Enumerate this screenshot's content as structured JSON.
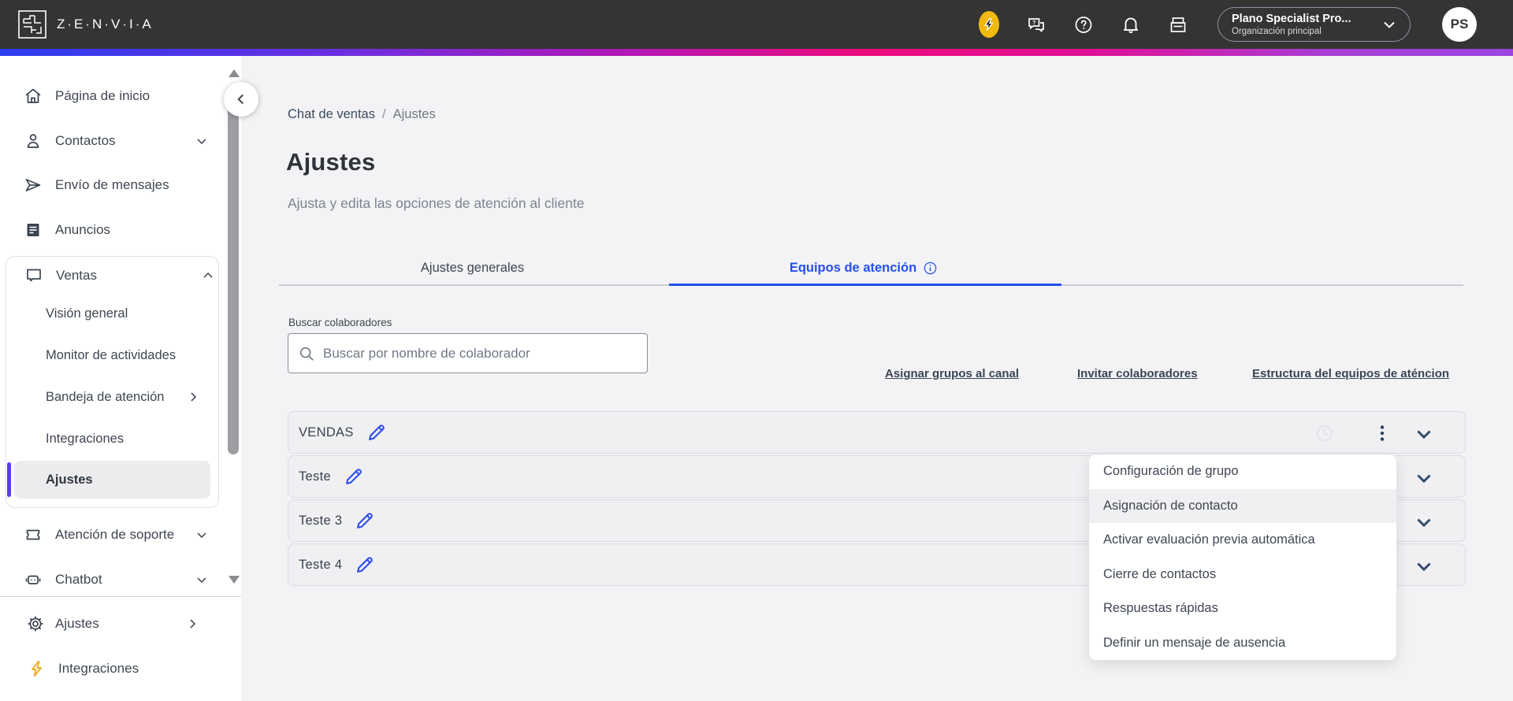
{
  "header": {
    "logo_text": "Z·E·N·V·I·A",
    "plan": {
      "name": "Plano Specialist Pro...",
      "org": "Organización principal"
    },
    "avatar_initials": "PS"
  },
  "sidebar": {
    "items": [
      {
        "label": "Página de inicio"
      },
      {
        "label": "Contactos"
      },
      {
        "label": "Envío de mensajes"
      },
      {
        "label": "Anuncios"
      },
      {
        "label": "Ventas"
      }
    ],
    "ventas_children": [
      {
        "label": "Visión general"
      },
      {
        "label": "Monitor de actividades"
      },
      {
        "label": "Bandeja de atención"
      },
      {
        "label": "Integraciones"
      },
      {
        "label": "Ajustes",
        "selected": true
      }
    ],
    "lower_items": [
      {
        "label": "Atención de soporte"
      },
      {
        "label": "Chatbot"
      }
    ],
    "bottom_items": [
      {
        "label": "Ajustes"
      },
      {
        "label": "Integraciones"
      }
    ]
  },
  "breadcrumb": {
    "parent": "Chat de ventas",
    "separator": "/",
    "current": "Ajustes"
  },
  "page": {
    "title": "Ajustes",
    "subtitle": "Ajusta y edita las opciones de atención al cliente"
  },
  "tabs": [
    {
      "label": "Ajustes generales",
      "active": false
    },
    {
      "label": "Equipos de atención",
      "active": true
    }
  ],
  "search": {
    "label": "Buscar colaboradores",
    "placeholder": "Buscar por nombre de colaborador",
    "value": ""
  },
  "action_links": [
    {
      "label": "Asignar grupos al canal"
    },
    {
      "label": "Invitar colaboradores"
    },
    {
      "label": "Estructura del equipos de aténcion"
    }
  ],
  "teams": [
    {
      "name": "VENDAS"
    },
    {
      "name": "Teste"
    },
    {
      "name": "Teste 3"
    },
    {
      "name": "Teste 4"
    }
  ],
  "context_menu": {
    "items": [
      {
        "label": "Configuración de grupo"
      },
      {
        "label": "Asignación de contacto",
        "highlighted": true
      },
      {
        "label": "Activar evaluación previa automática"
      },
      {
        "label": "Cierre de contactos"
      },
      {
        "label": "Respuestas rápidas"
      },
      {
        "label": "Definir un mensaje de ausencia"
      }
    ]
  },
  "colors": {
    "accent_blue": "#2450f0",
    "accent_purple": "#5a3bf0",
    "brand_yellow": "#efb910",
    "gradient": [
      "#2b3df2",
      "#ec0b7d",
      "#9b44e0"
    ],
    "topbar_bg": "#343434"
  }
}
